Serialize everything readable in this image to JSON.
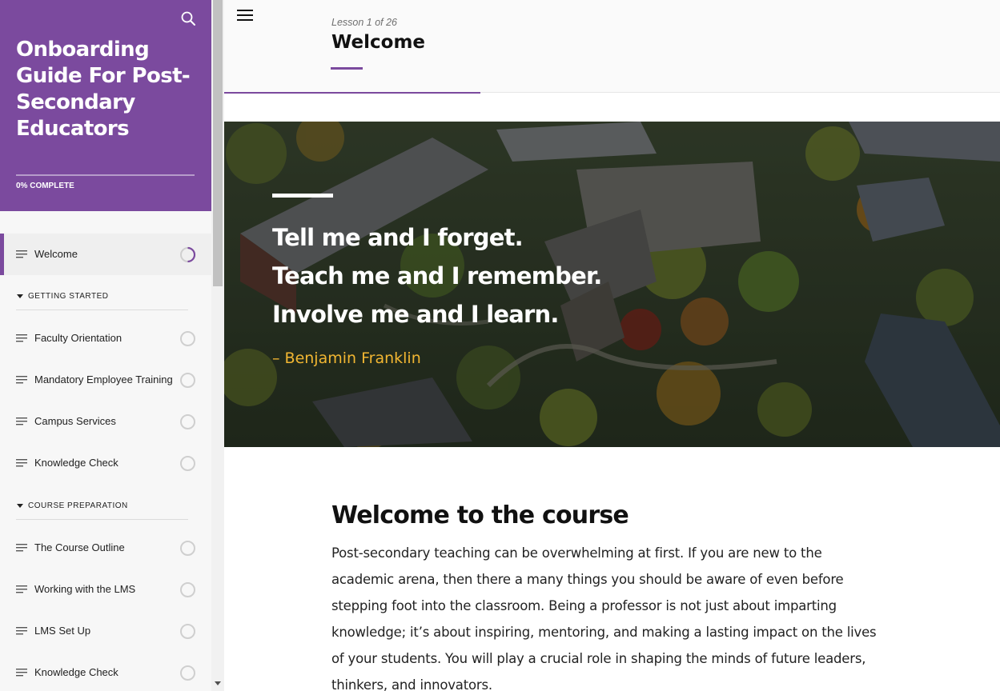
{
  "sidebar": {
    "course_title": "Onboarding Guide For Post-Secondary Educators",
    "progress_label": "0% COMPLETE",
    "progress_fraction": 0.0,
    "search_icon": "search-icon",
    "active_lesson": {
      "label": "Welcome",
      "status": "in-progress"
    },
    "sections": [
      {
        "title": "GETTING STARTED",
        "lessons": [
          {
            "label": "Faculty Orientation",
            "status": "incomplete"
          },
          {
            "label": "Mandatory Employee Training",
            "status": "incomplete"
          },
          {
            "label": "Campus Services",
            "status": "incomplete"
          },
          {
            "label": "Knowledge Check",
            "status": "incomplete"
          }
        ]
      },
      {
        "title": "COURSE PREPARATION",
        "lessons": [
          {
            "label": "The Course Outline",
            "status": "incomplete"
          },
          {
            "label": "Working with the LMS",
            "status": "incomplete"
          },
          {
            "label": "LMS Set Up",
            "status": "incomplete"
          },
          {
            "label": "Knowledge Check",
            "status": "incomplete"
          }
        ]
      }
    ]
  },
  "header": {
    "menu_icon": "hamburger-menu-icon",
    "lesson_counter": "Lesson 1 of 26",
    "lesson_title": "Welcome",
    "progress_fraction": 0.33
  },
  "hero": {
    "quote_lines": [
      "Tell me and I forget.",
      "Teach me and I remember.",
      "Involve me and I learn."
    ],
    "author": "– Benjamin Franklin"
  },
  "content": {
    "heading": "Welcome to the course",
    "body": "Post-secondary teaching can be overwhelming at first. If you are new to the academic arena, then there a many things you should be aware of even before stepping foot into the classroom. Being a professor is not just about imparting knowledge; it’s about inspiring, mentoring, and making a lasting impact on the lives of your students. You will play a crucial role in shaping the minds of future leaders, thinkers, and innovators."
  },
  "colors": {
    "accent": "#7b4a9e",
    "quote_author": "#f2b632",
    "sidebar_bg": "#f7f7f7"
  }
}
